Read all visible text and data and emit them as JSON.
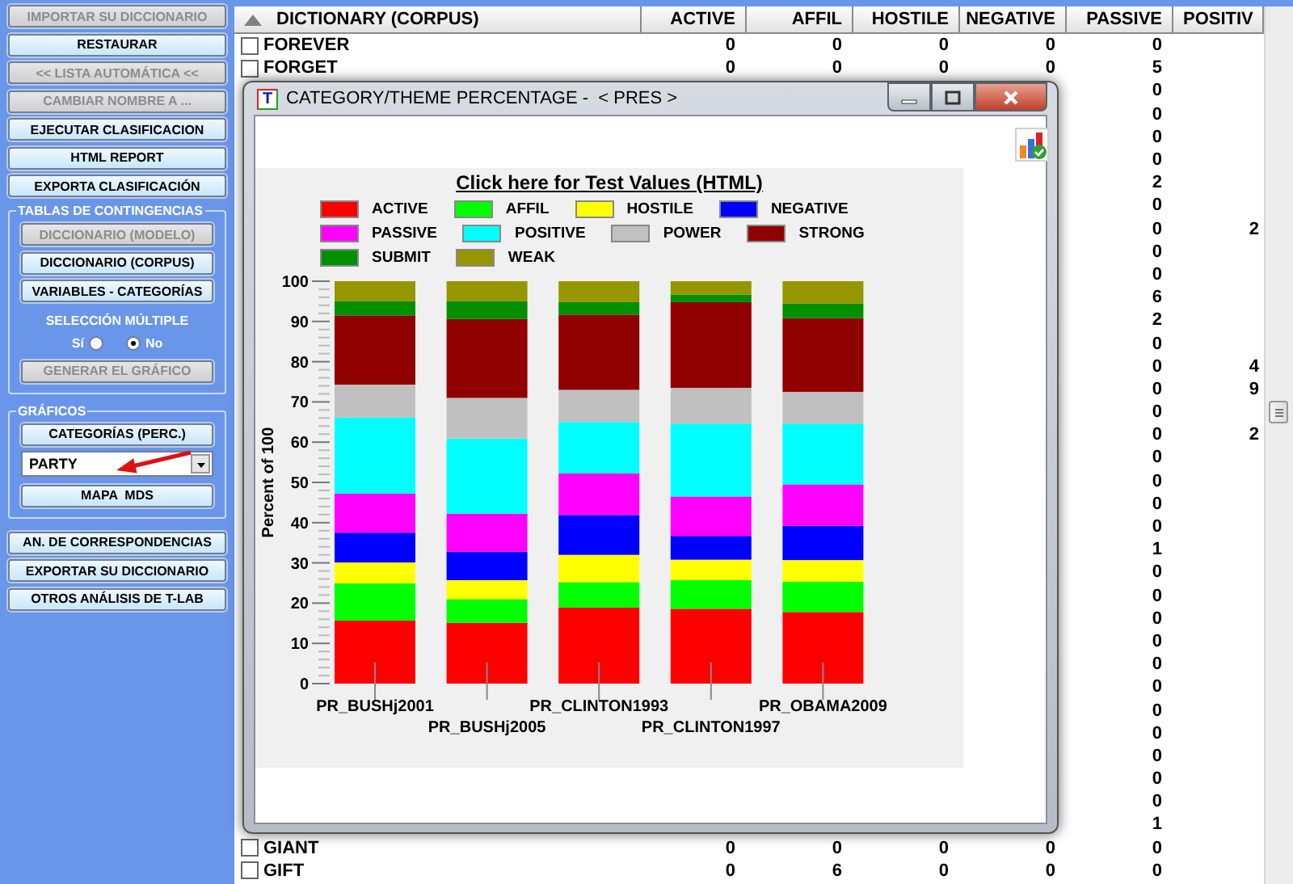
{
  "sidebar": {
    "top_buttons": [
      {
        "label": "IMPORTAR SU DICCIONARIO",
        "disabled": true
      },
      {
        "label": "RESTAURAR",
        "disabled": false
      },
      {
        "label": "<< LISTA AUTOMÁTICA <<",
        "disabled": true
      },
      {
        "label": "CAMBIAR NOMBRE A ...",
        "disabled": true
      },
      {
        "label": "EJECUTAR CLASIFICACION",
        "disabled": false
      },
      {
        "label": "HTML REPORT",
        "disabled": false
      },
      {
        "label": "EXPORTA CLASIFICACIÓN",
        "disabled": false
      }
    ],
    "groups": [
      {
        "title": "TABLAS DE CONTINGENCIAS",
        "items": [
          {
            "kind": "button",
            "label": "DICCIONARIO (MODELO)",
            "disabled": true
          },
          {
            "kind": "button",
            "label": "DICCIONARIO (CORPUS)",
            "disabled": false
          },
          {
            "kind": "button",
            "label": "VARIABLES - CATEGORÍAS",
            "disabled": false
          },
          {
            "kind": "caption",
            "label": "SELECCIÓN MÚLTIPLE"
          },
          {
            "kind": "radios",
            "options": [
              {
                "label": "Sí",
                "selected": false
              },
              {
                "label": "No",
                "selected": true
              }
            ]
          },
          {
            "kind": "button",
            "label": "GENERAR EL GRÁFICO",
            "disabled": true
          }
        ]
      },
      {
        "title": "GRÁFICOS",
        "items": [
          {
            "kind": "button",
            "label": "CATEGORÍAS (PERC.)",
            "disabled": false
          },
          {
            "kind": "dropdown",
            "value": "PARTY"
          },
          {
            "kind": "button",
            "label": "MAPA  MDS",
            "disabled": false
          }
        ]
      }
    ],
    "bottom_buttons": [
      {
        "label": "AN. DE CORRESPONDENCIAS",
        "disabled": false
      },
      {
        "label": "EXPORTAR SU DICCIONARIO",
        "disabled": false
      },
      {
        "label": "OTROS ANÁLISIS DE T-LAB",
        "disabled": false
      }
    ]
  },
  "table": {
    "columns": [
      "DICTIONARY (CORPUS)",
      "ACTIVE",
      "AFFIL",
      "HOSTILE",
      "NEGATIVE",
      "PASSIVE",
      "POSITIV"
    ],
    "rows": [
      {
        "checked": false,
        "cells": [
          "FOREVER",
          "0",
          "0",
          "0",
          "0",
          "0",
          null
        ]
      },
      {
        "checked": false,
        "cells": [
          "FORGET",
          "0",
          "0",
          "0",
          "0",
          "5",
          null
        ]
      },
      {
        "cells": [
          null,
          null,
          null,
          null,
          null,
          "0",
          null
        ]
      },
      {
        "cells": [
          null,
          null,
          null,
          null,
          null,
          "0",
          null
        ]
      },
      {
        "cells": [
          null,
          null,
          null,
          null,
          null,
          "0",
          null
        ]
      },
      {
        "cells": [
          null,
          null,
          null,
          null,
          null,
          "0",
          null
        ]
      },
      {
        "cells": [
          null,
          null,
          null,
          null,
          null,
          "2",
          null
        ]
      },
      {
        "cells": [
          null,
          null,
          null,
          null,
          null,
          "0",
          null
        ]
      },
      {
        "cells": [
          null,
          null,
          null,
          null,
          null,
          "0",
          "2"
        ]
      },
      {
        "cells": [
          null,
          null,
          null,
          null,
          null,
          "0",
          null
        ]
      },
      {
        "cells": [
          null,
          null,
          null,
          null,
          null,
          "0",
          null
        ]
      },
      {
        "cells": [
          null,
          null,
          null,
          null,
          null,
          "6",
          null
        ]
      },
      {
        "cells": [
          null,
          null,
          null,
          null,
          null,
          "2",
          null
        ]
      },
      {
        "cells": [
          null,
          null,
          null,
          null,
          null,
          "0",
          null
        ]
      },
      {
        "cells": [
          null,
          null,
          null,
          null,
          null,
          "0",
          "4"
        ]
      },
      {
        "cells": [
          null,
          null,
          null,
          null,
          null,
          "0",
          "9"
        ]
      },
      {
        "cells": [
          null,
          null,
          null,
          null,
          null,
          "0",
          null
        ]
      },
      {
        "cells": [
          null,
          null,
          null,
          null,
          null,
          "0",
          "2"
        ]
      },
      {
        "cells": [
          null,
          null,
          null,
          null,
          null,
          "0",
          null
        ]
      },
      {
        "cells": [
          null,
          null,
          null,
          null,
          null,
          "0",
          null
        ]
      },
      {
        "cells": [
          null,
          null,
          null,
          null,
          null,
          "0",
          null
        ]
      },
      {
        "cells": [
          null,
          null,
          null,
          null,
          null,
          "0",
          null
        ]
      },
      {
        "cells": [
          null,
          null,
          null,
          null,
          null,
          "1",
          null
        ]
      },
      {
        "cells": [
          null,
          null,
          null,
          null,
          null,
          "0",
          null
        ]
      },
      {
        "cells": [
          null,
          null,
          null,
          null,
          null,
          "0",
          null
        ]
      },
      {
        "cells": [
          null,
          null,
          null,
          null,
          null,
          "0",
          null
        ]
      },
      {
        "cells": [
          null,
          null,
          null,
          null,
          null,
          "0",
          null
        ]
      },
      {
        "cells": [
          null,
          null,
          null,
          null,
          null,
          "0",
          null
        ]
      },
      {
        "cells": [
          null,
          null,
          null,
          null,
          null,
          "0",
          null
        ]
      },
      {
        "cells": [
          null,
          null,
          null,
          null,
          null,
          "0",
          null
        ]
      },
      {
        "cells": [
          null,
          null,
          null,
          null,
          null,
          "0",
          null
        ]
      },
      {
        "cells": [
          null,
          null,
          null,
          null,
          null,
          "0",
          null
        ]
      },
      {
        "cells": [
          null,
          null,
          null,
          null,
          null,
          "0",
          null
        ]
      },
      {
        "cells": [
          null,
          null,
          null,
          null,
          null,
          "0",
          null
        ]
      },
      {
        "cells": [
          null,
          null,
          null,
          null,
          null,
          "1",
          null
        ]
      },
      {
        "checked": false,
        "cells": [
          "GIANT",
          "0",
          "0",
          "0",
          "0",
          "0",
          null
        ]
      },
      {
        "checked": false,
        "cells": [
          "GIFT",
          "0",
          "6",
          "0",
          "0",
          "0",
          null
        ]
      }
    ]
  },
  "window": {
    "icon_letter": "T",
    "title": "CATEGORY/THEME PERCENTAGE -  < PRES >",
    "chart_data": {
      "type": "bar",
      "stacked": true,
      "legend": "top",
      "title": "Click here for Test Values (HTML)",
      "ylabel": "Percent of 100",
      "ylim": [
        0,
        100
      ],
      "yticks": [
        0,
        10,
        20,
        30,
        40,
        50,
        60,
        70,
        80,
        90,
        100
      ],
      "categories": [
        "PR_BUSHj2001",
        "PR_BUSHj2005",
        "PR_CLINTON1993",
        "PR_CLINTON1997",
        "PR_OBAMA2009"
      ],
      "series": [
        {
          "name": "ACTIVE",
          "color": "#ff0000",
          "values": [
            15.7,
            15.1,
            18.9,
            18.6,
            17.8
          ]
        },
        {
          "name": "AFFIL",
          "color": "#00ff00",
          "values": [
            9.2,
            5.9,
            6.3,
            7.1,
            7.5
          ]
        },
        {
          "name": "HOSTILE",
          "color": "#ffff00",
          "values": [
            5.2,
            4.7,
            6.8,
            5.1,
            5.4
          ]
        },
        {
          "name": "NEGATIVE",
          "color": "#0000ff",
          "values": [
            7.4,
            7.1,
            9.9,
            5.9,
            8.5
          ]
        },
        {
          "name": "PASSIVE",
          "color": "#ff00ff",
          "values": [
            9.7,
            9.4,
            10.3,
            9.8,
            10.3
          ]
        },
        {
          "name": "POSITIVE",
          "color": "#00ffff",
          "values": [
            18.9,
            18.7,
            12.8,
            18.1,
            15.1
          ]
        },
        {
          "name": "POWER",
          "color": "#c0c0c0",
          "values": [
            8.2,
            10.1,
            8.0,
            8.9,
            7.9
          ]
        },
        {
          "name": "STRONG",
          "color": "#900000",
          "values": [
            17.2,
            19.6,
            18.7,
            21.3,
            18.3
          ]
        },
        {
          "name": "SUBMIT",
          "color": "#009000",
          "values": [
            3.5,
            4.4,
            3.1,
            1.9,
            3.7
          ]
        },
        {
          "name": "WEAK",
          "color": "#969600",
          "values": [
            5.0,
            5.0,
            5.2,
            3.3,
            5.5
          ]
        }
      ]
    }
  }
}
